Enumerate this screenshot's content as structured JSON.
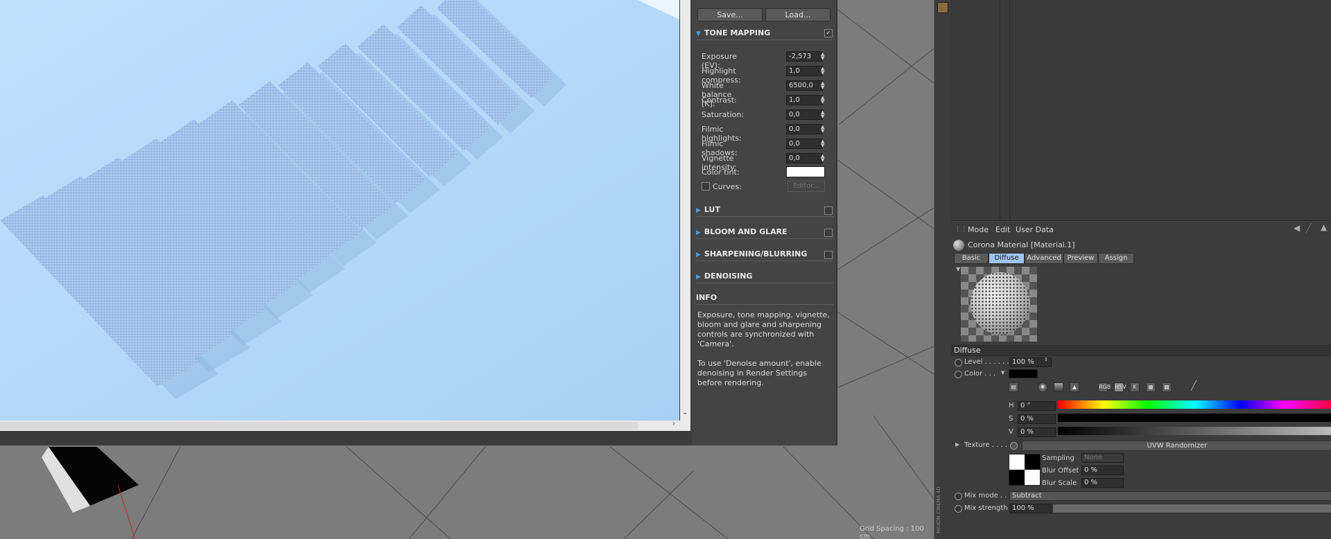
{
  "vfb": {
    "save_label": "Save...",
    "load_label": "Load...",
    "tone_mapping": {
      "title": "TONE MAPPING",
      "rows": [
        {
          "label": "Exposure (EV):",
          "value": "-2,573"
        },
        {
          "label": "Highlight compress:",
          "value": "1,0"
        },
        {
          "label": "White balance [K]:",
          "value": "6500,0"
        },
        {
          "label": "Contrast:",
          "value": "1,0"
        },
        {
          "label": "Saturation:",
          "value": "0,0"
        },
        {
          "label": "Filmic highlights:",
          "value": "0,0"
        },
        {
          "label": "Filmic shadows:",
          "value": "0,0"
        },
        {
          "label": "Vignette intensity:",
          "value": "0,0"
        }
      ],
      "color_tint_label": "Color tint:",
      "color_tint_value": "#ffffff",
      "curves_label": "Curves:",
      "editor_label": "Editor..."
    },
    "sections": [
      "LUT",
      "BLOOM AND GLARE",
      "SHARPENING/BLURRING",
      "DENOISING"
    ],
    "info": {
      "title": "INFO",
      "para1": "Exposure, tone mapping, vignette, bloom and glare and sharpening controls are synchronized with 'Camera'.",
      "para2": "To use 'Denoise amount', enable denoising in Render Settings before rendering."
    }
  },
  "viewport": {
    "grid_spacing": "Grid Spacing : 100 cm"
  },
  "attributes": {
    "menu": [
      "Mode",
      "Edit",
      "User Data"
    ],
    "object_title": "Corona Material [Material.1]",
    "tabs": [
      {
        "label": "Basic",
        "active": false
      },
      {
        "label": "Diffuse",
        "active": true
      },
      {
        "label": "Advanced",
        "active": false
      },
      {
        "label": "Preview",
        "active": false
      },
      {
        "label": "Assign",
        "active": false
      }
    ],
    "section_title": "Diffuse",
    "level_label": "Level . . . . . . .",
    "level_value": "100 %",
    "color_label": "Color . . .",
    "h_label": "H",
    "h_value": "0 °",
    "s_label": "S",
    "s_value": "0 %",
    "v_label": "V",
    "v_value": "0 %",
    "texture_label": "Texture . . . . .",
    "texture_name": "UVW Randomizer",
    "sampling_label": "Sampling",
    "sampling_value": "None",
    "blur_offset_label": "Blur Offset",
    "blur_offset_value": "0 %",
    "blur_scale_label": "Blur Scale",
    "blur_scale_value": "0 %",
    "mix_mode_label": "Mix mode . .",
    "mix_mode_value": "Subtract",
    "mix_strength_label": "Mix strength",
    "mix_strength_value": "100 %",
    "hsv_btn": "HSV",
    "rgb_btn": "RGB",
    "k_btn": "K",
    "brand": "MAXON CINEMA 4D"
  },
  "colors": {
    "accent": "#4a9de0",
    "render_bg": "#b5dafb",
    "tab_active": "#9fc4f0"
  }
}
